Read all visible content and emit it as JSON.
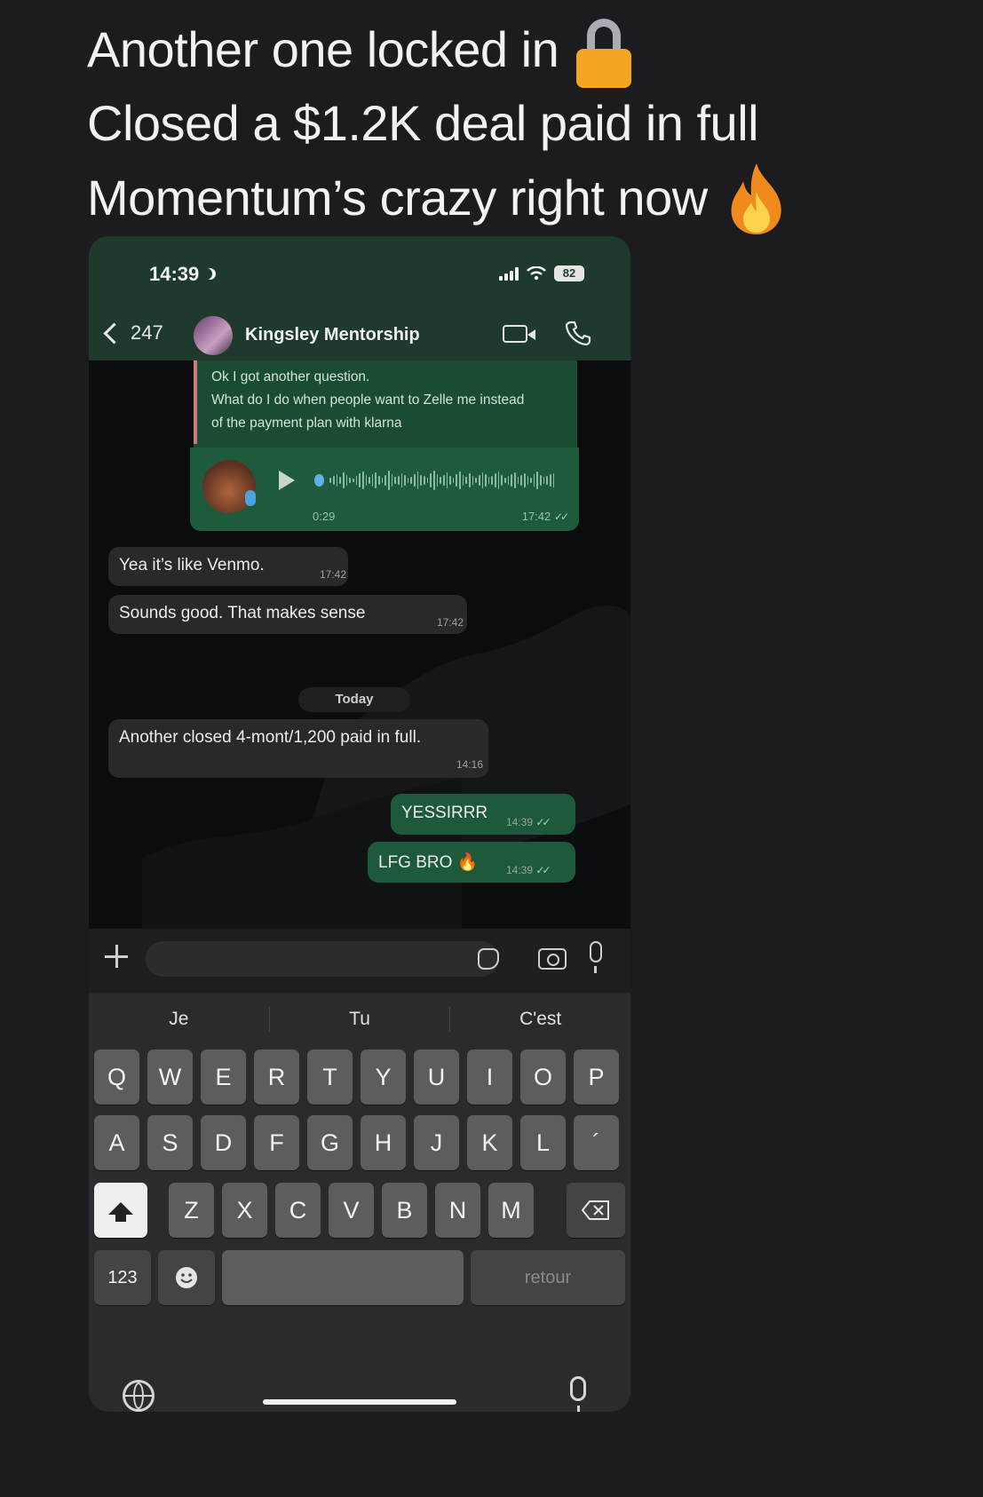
{
  "caption": {
    "line1": "Another one locked in",
    "line2": "Closed a $1.2K deal paid in full",
    "line3": "Momentum’s crazy right now",
    "icons": [
      "lock-icon",
      "fire-icon"
    ]
  },
  "status_bar": {
    "time": "14:39",
    "battery": "82"
  },
  "chat_header": {
    "back_count": "247",
    "title": "Kingsley Mentorship"
  },
  "messages": {
    "quoted": {
      "line1": "Ok I got another question.",
      "line2": "What do I do when people want to Zelle me instead",
      "line3": "of the payment plan with klarna"
    },
    "voice": {
      "duration": "0:29",
      "time": "17:42"
    },
    "m1": {
      "text": "Yea it’s like Venmo.",
      "time": "17:42"
    },
    "m2": {
      "text": "Sounds good. That makes sense",
      "time": "17:42"
    },
    "date_separator": "Today",
    "m3": {
      "text": "Another closed 4-mont/1,200 paid in full.",
      "time": "14:16"
    },
    "m4": {
      "text": "YESSIRRR",
      "time": "14:39"
    },
    "m5": {
      "text": "LFG BRO 🔥",
      "time": "14:39"
    }
  },
  "keyboard": {
    "suggestions": [
      "Je",
      "Tu",
      "C'est"
    ],
    "row1": [
      "Q",
      "W",
      "E",
      "R",
      "T",
      "Y",
      "U",
      "I",
      "O",
      "P"
    ],
    "row2": [
      "A",
      "S",
      "D",
      "F",
      "G",
      "H",
      "J",
      "K",
      "L",
      "´"
    ],
    "row3": [
      "Z",
      "X",
      "C",
      "V",
      "B",
      "N",
      "M"
    ],
    "numbers_key": "123",
    "return_key": "retour"
  },
  "colors": {
    "background": "#1b1b20",
    "header_green": "#1d3a2c",
    "outgoing_bubble": "#1d5a3c",
    "incoming_bubble": "#27292b",
    "lock_body": "#f5a524"
  }
}
